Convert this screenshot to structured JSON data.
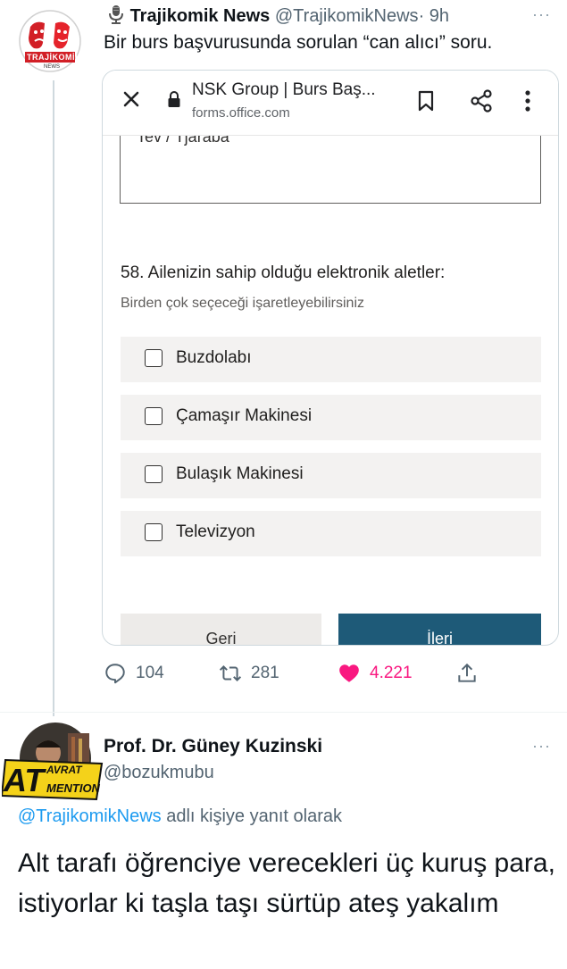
{
  "tweet": {
    "author_name": "Trajikomik News",
    "author_handle": "@TrajikomikNews",
    "time": "· 9h",
    "text": "Bir burs başvurusunda sorulan “can alıcı” soru.",
    "more": "···",
    "avatar_text": "TRAJİKOMİK",
    "avatar_subtext": "NEWS"
  },
  "browser": {
    "title": "NSK Group | Burs Baş...",
    "url": "forms.office.com"
  },
  "form": {
    "previous_answer": "Tev / Tjaraba",
    "question": "58. Ailenizin sahip olduğu elektronik aletler:",
    "hint": "Birden çok seçeceği işaretleyebilirsiniz",
    "options": [
      "Buzdolabı",
      "Çamaşır Makinesi",
      "Bulaşık Makinesi",
      "Televizyon"
    ],
    "back_label": "Geri",
    "next_label": "İleri"
  },
  "actions": {
    "replies": "104",
    "retweets": "281",
    "likes": "4.221"
  },
  "reply_tweet": {
    "author_name": "Prof. Dr. Güney Kuzinski",
    "author_handle": "@bozukmubu",
    "more": "···",
    "reply_to_handle": "@TrajikomikNews",
    "reply_to_suffix": " adlı kişiye yanıt olarak",
    "text": "Alt tarafı öğrenciye verecekleri üç kuruş para, istiyorlar ki taşla taşı sürtüp ateş yakalım",
    "avatar_badge_big": "AT",
    "avatar_badge_top": "AVRAT",
    "avatar_badge_bottom": "MENTION"
  },
  "colors": {
    "like": "#f91880",
    "link": "#1d9bf0",
    "next_button": "#1e5a78",
    "muted": "#536471"
  }
}
